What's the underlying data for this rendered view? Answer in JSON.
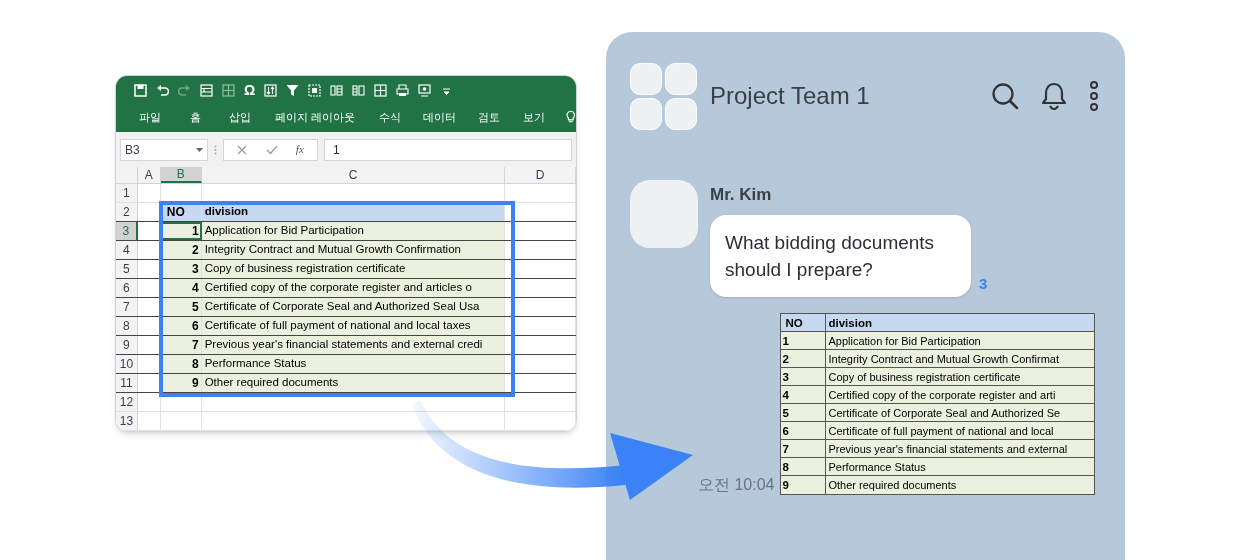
{
  "spreadsheet": {
    "quick_access_symbol": "Ω",
    "menu_tabs": [
      "파일",
      "홈",
      "삽입",
      "페이지 레이아웃",
      "수식",
      "데이터",
      "검토",
      "보기"
    ],
    "name_box": "B3",
    "formula_symbol": "fx",
    "formula": "1",
    "column_headers": [
      {
        "label": "A",
        "selected": false
      },
      {
        "label": "B",
        "selected": true
      },
      {
        "label": "C",
        "selected": false
      },
      {
        "label": "D",
        "selected": false
      }
    ],
    "row_numbers": [
      {
        "label": "1",
        "selected": false
      },
      {
        "label": "2",
        "selected": false
      },
      {
        "label": "3",
        "selected": true
      },
      {
        "label": "4",
        "selected": false
      },
      {
        "label": "5",
        "selected": false
      },
      {
        "label": "6",
        "selected": false
      },
      {
        "label": "7",
        "selected": false
      },
      {
        "label": "8",
        "selected": false
      },
      {
        "label": "9",
        "selected": false
      },
      {
        "label": "10",
        "selected": false
      },
      {
        "label": "11",
        "selected": false
      },
      {
        "label": "12",
        "selected": false
      },
      {
        "label": "13",
        "selected": false
      }
    ],
    "table": {
      "columns": [
        "NO",
        "division"
      ],
      "rows": [
        {
          "no": "1",
          "division": "Application for Bid Participation"
        },
        {
          "no": "2",
          "division": "Integrity Contract and Mutual Growth Confirmation"
        },
        {
          "no": "3",
          "division": "Copy of business registration certificate"
        },
        {
          "no": "4",
          "division": "Certified copy of the corporate register and articles o"
        },
        {
          "no": "5",
          "division": "Certificate of Corporate Seal and Authorized Seal Usa"
        },
        {
          "no": "6",
          "division": "Certificate of full payment of national and local taxes"
        },
        {
          "no": "7",
          "division": "Previous year's financial statements and external credi"
        },
        {
          "no": "8",
          "division": "Performance Status"
        },
        {
          "no": "9",
          "division": "Other required documents"
        }
      ]
    }
  },
  "chat": {
    "title": "Project Team 1",
    "sender": "Mr. Kim",
    "message": "What bidding documents should I prepare?",
    "unread_count": "3",
    "time": "오전 10:04",
    "table": {
      "columns": [
        "NO",
        "division"
      ],
      "rows": [
        {
          "no": "1",
          "division": "Application for Bid Participation"
        },
        {
          "no": "2",
          "division": "Integrity Contract and Mutual Growth Confirmat"
        },
        {
          "no": "3",
          "division": "Copy of business registration certificate"
        },
        {
          "no": "4",
          "division": "Certified copy of the corporate register and arti"
        },
        {
          "no": "5",
          "division": "Certificate of Corporate Seal and Authorized Se"
        },
        {
          "no": "6",
          "division": "Certificate of full payment of national and local"
        },
        {
          "no": "7",
          "division": "Previous year's financial statements and external"
        },
        {
          "no": "8",
          "division": "Performance Status"
        },
        {
          "no": "9",
          "division": "Other required documents"
        }
      ]
    }
  }
}
